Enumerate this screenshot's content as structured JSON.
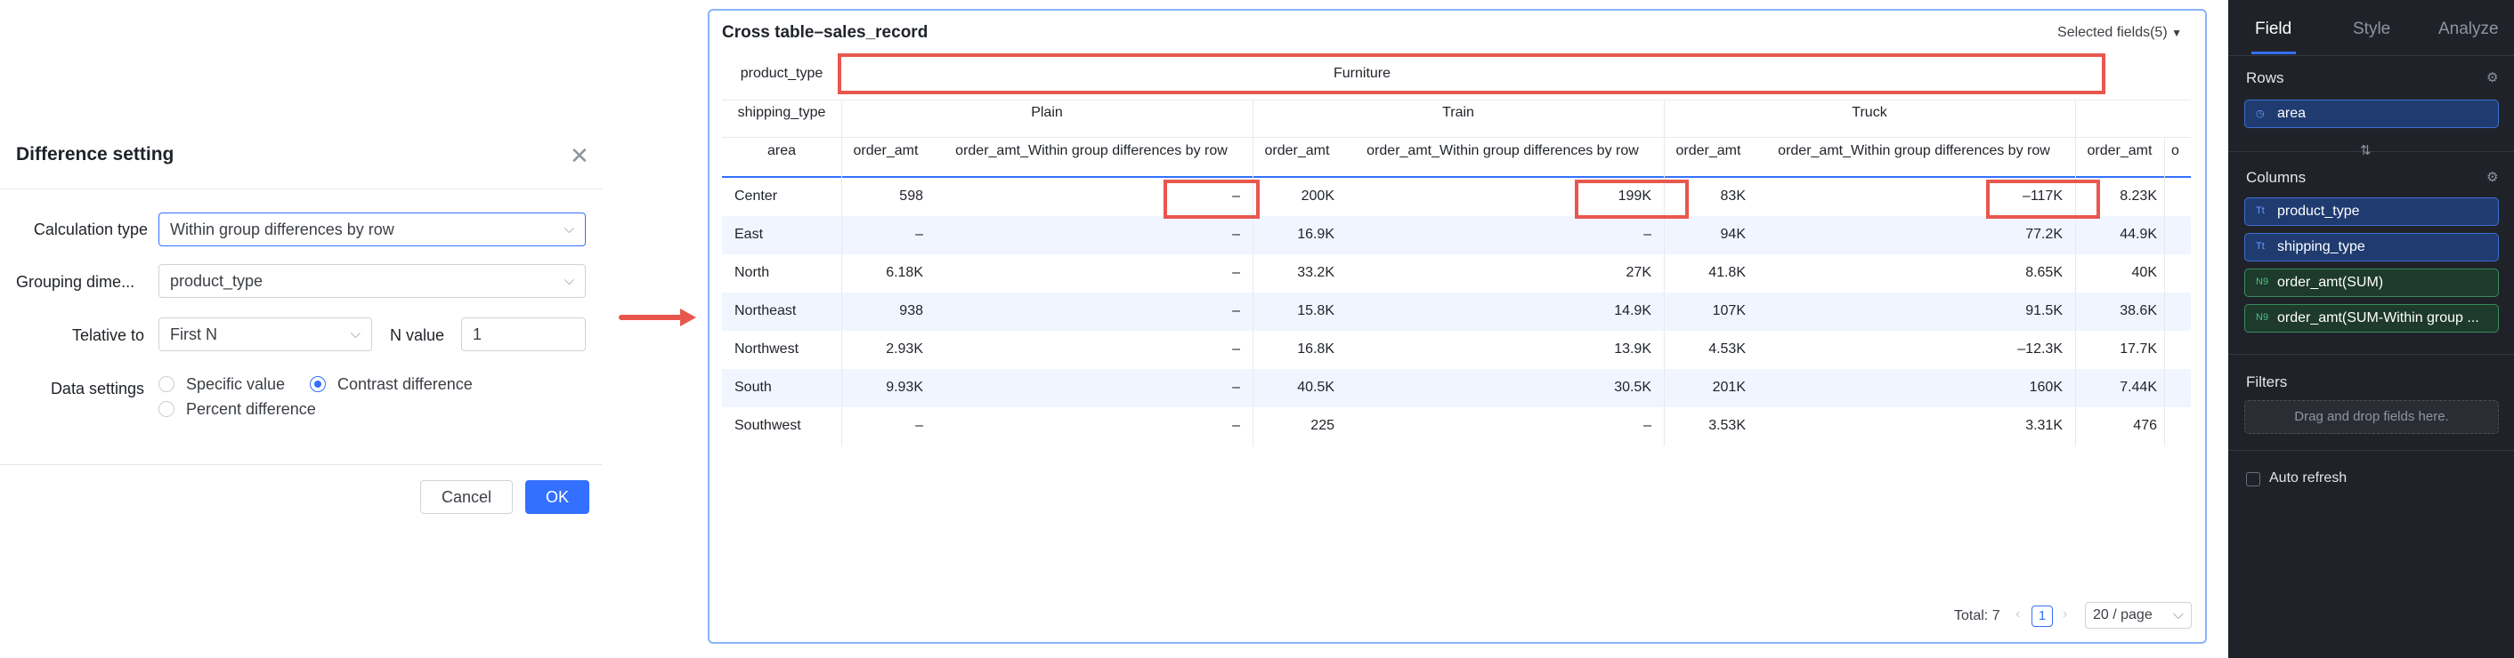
{
  "dialog": {
    "title": "Difference setting",
    "fields": {
      "calc_type_label": "Calculation type",
      "calc_type_value": "Within group differences by row",
      "grouping_label": "Grouping dime...",
      "grouping_value": "product_type",
      "relative_label": "Telative to",
      "relative_value": "First N",
      "n_label": "N value",
      "n_value": "1",
      "data_settings_label": "Data settings",
      "opt_specific": "Specific value",
      "opt_contrast": "Contrast difference",
      "opt_percent": "Percent difference",
      "selected_option": "Contrast difference"
    },
    "cancel_label": "Cancel",
    "ok_label": "OK"
  },
  "table": {
    "title": "Cross table–sales_record",
    "selected_fields": "Selected fields(5)",
    "header": {
      "product_type_label": "product_type",
      "product_type_value": "Furniture",
      "shipping_type_label": "shipping_type",
      "area_label": "area",
      "groups": [
        "Plain",
        "Train",
        "Truck"
      ],
      "col_amt": "order_amt",
      "col_diff": "order_amt_Within group differences by row",
      "col_amt_trunc": "order_amt",
      "col_extra_trunc": "o"
    },
    "rows": [
      {
        "area": "Center",
        "plain_amt": "598",
        "plain_diff": "–",
        "train_amt": "200K",
        "train_diff": "199K",
        "truck_amt": "83K",
        "truck_diff": "–117K",
        "next_amt": "8.23K"
      },
      {
        "area": "East",
        "plain_amt": "–",
        "plain_diff": "–",
        "train_amt": "16.9K",
        "train_diff": "–",
        "truck_amt": "94K",
        "truck_diff": "77.2K",
        "next_amt": "44.9K"
      },
      {
        "area": "North",
        "plain_amt": "6.18K",
        "plain_diff": "–",
        "train_amt": "33.2K",
        "train_diff": "27K",
        "truck_amt": "41.8K",
        "truck_diff": "8.65K",
        "next_amt": "40K"
      },
      {
        "area": "Northeast",
        "plain_amt": "938",
        "plain_diff": "–",
        "train_amt": "15.8K",
        "train_diff": "14.9K",
        "truck_amt": "107K",
        "truck_diff": "91.5K",
        "next_amt": "38.6K"
      },
      {
        "area": "Northwest",
        "plain_amt": "2.93K",
        "plain_diff": "–",
        "train_amt": "16.8K",
        "train_diff": "13.9K",
        "truck_amt": "4.53K",
        "truck_diff": "–12.3K",
        "next_amt": "17.7K"
      },
      {
        "area": "South",
        "plain_amt": "9.93K",
        "plain_diff": "–",
        "train_amt": "40.5K",
        "train_diff": "30.5K",
        "truck_amt": "201K",
        "truck_diff": "160K",
        "next_amt": "7.44K"
      },
      {
        "area": "Southwest",
        "plain_amt": "–",
        "plain_diff": "–",
        "train_amt": "225",
        "train_diff": "–",
        "truck_amt": "3.53K",
        "truck_diff": "3.31K",
        "next_amt": "476"
      }
    ],
    "pagination": {
      "total": "Total: 7",
      "page": "1",
      "page_size": "20 / page"
    }
  },
  "sidebar": {
    "tabs": [
      "Field",
      "Style",
      "Analyze"
    ],
    "active_tab": "Field",
    "rows_label": "Rows",
    "rows_fields": [
      "area"
    ],
    "columns_label": "Columns",
    "columns_fields": [
      "product_type",
      "shipping_type"
    ],
    "value_fields": [
      "order_amt(SUM)",
      "order_amt(SUM-Within group ..."
    ],
    "filters_label": "Filters",
    "filters_placeholder": "Drag and drop fields here.",
    "auto_refresh_label": "Auto refresh",
    "icon_text": "Tt",
    "icon_num": "N9"
  },
  "colors": {
    "accent": "#3370ff",
    "highlight_box": "#e8574e",
    "row_stripe": "#f1f5ff",
    "sidebar_bg": "#1f2329"
  }
}
